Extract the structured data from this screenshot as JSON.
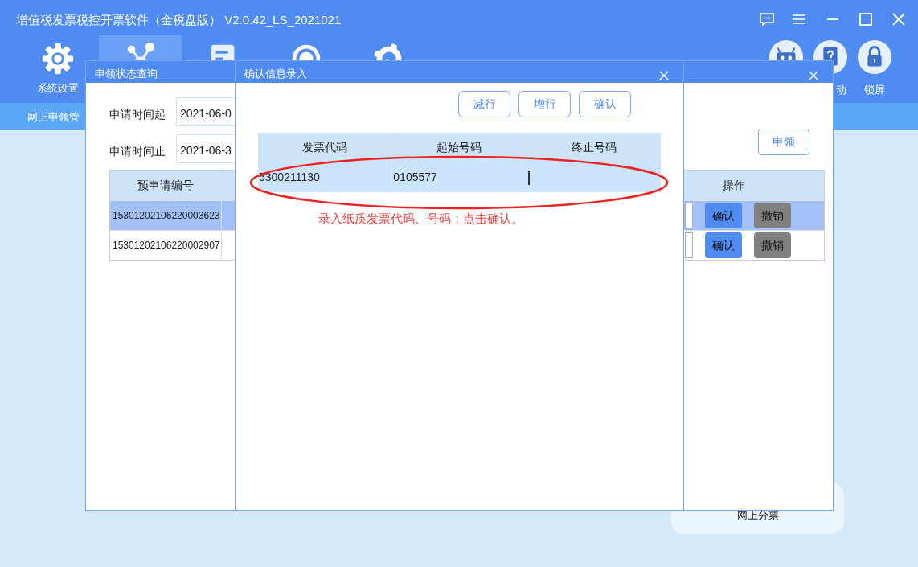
{
  "app": {
    "title": "增值税发票税控开票软件（金税盘版） V2.0.42_LS_2021021",
    "toolbar": [
      {
        "kind": "gear",
        "label": "系统设置",
        "selected": false
      },
      {
        "kind": "nodes",
        "selected": true
      },
      {
        "kind": "doc",
        "selected": false
      },
      {
        "kind": "tax",
        "selected": false
      },
      {
        "kind": "gauge",
        "selected": false
      }
    ],
    "tools_right": [
      {
        "kind": "robot"
      },
      {
        "kind": "help",
        "label": "动"
      },
      {
        "kind": "lock",
        "label": "锁屏"
      }
    ],
    "nav": "网上申领管",
    "bottom_card": "网上分票"
  },
  "query_window": {
    "title": "申领状态查询",
    "fields": [
      {
        "label": "申请时间起",
        "value": "2021-06-0"
      },
      {
        "label": "申请时间止",
        "value": "2021-06-3"
      }
    ],
    "apply_button": "申领",
    "columns": [
      "预申请编号",
      "操作"
    ],
    "rows": [
      {
        "id": "15301202106220003623",
        "selected": true,
        "actions": [
          "确认",
          "撤销"
        ]
      },
      {
        "id": "15301202106220002907",
        "selected": false,
        "actions": [
          "确认",
          "撤销"
        ]
      }
    ]
  },
  "entry_window": {
    "title": "确认信息录入",
    "buttons": [
      "减行",
      "增行",
      "确认"
    ],
    "columns": [
      "发票代码",
      "起始号码",
      "终止号码"
    ],
    "rows": [
      {
        "cells": [
          "5300211130",
          "0105577",
          ""
        ],
        "selected": true
      }
    ],
    "annotation": "录入纸质发票代码、号码；点击确认。"
  }
}
